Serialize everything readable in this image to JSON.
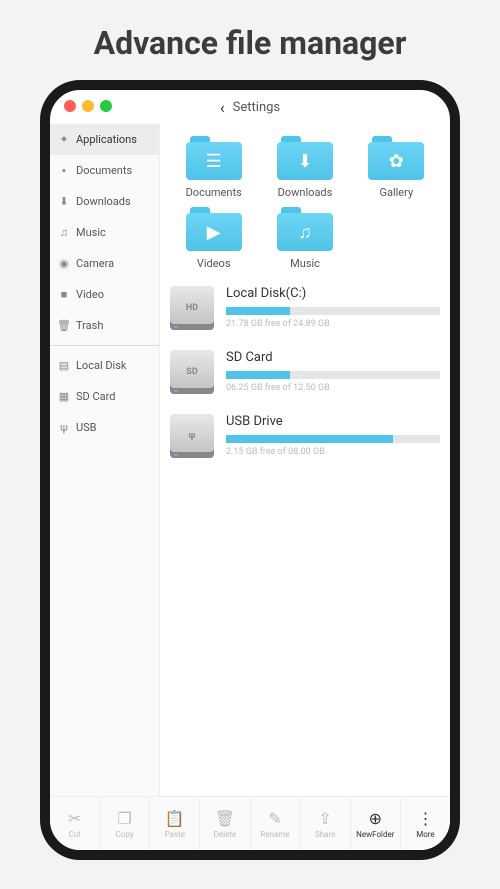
{
  "page_title": "Advance file manager",
  "titlebar": {
    "back": "‹",
    "title": "Settings"
  },
  "sidebar": {
    "items_top": [
      {
        "icon": "✦",
        "label": "Applications",
        "active": true
      },
      {
        "icon": "▪",
        "label": "Documents"
      },
      {
        "icon": "⬇",
        "label": "Downloads"
      },
      {
        "icon": "♫",
        "label": "Music"
      },
      {
        "icon": "◉",
        "label": "Camera"
      },
      {
        "icon": "■",
        "label": "Video"
      },
      {
        "icon": "🗑",
        "label": "Trash"
      }
    ],
    "items_bottom": [
      {
        "icon": "▤",
        "label": "Local Disk"
      },
      {
        "icon": "▦",
        "label": "SD Card"
      },
      {
        "icon": "ψ",
        "label": "USB"
      }
    ]
  },
  "folders": [
    {
      "glyph": "☰",
      "label": "Documents"
    },
    {
      "glyph": "⬇",
      "label": "Downloads"
    },
    {
      "glyph": "✿",
      "label": "Gallery"
    },
    {
      "glyph": "▶",
      "label": "Videos"
    },
    {
      "glyph": "♫",
      "label": "Music"
    }
  ],
  "drives": [
    {
      "badge": "HD",
      "name": "Local Disk(C:)",
      "percent": 30,
      "sub": "21.78 GB free of 24.89 GB"
    },
    {
      "badge": "SD",
      "name": "SD Card",
      "percent": 30,
      "sub": "06.25 GB free of 12.50 GB"
    },
    {
      "badge": "ψ",
      "name": "USB Drive",
      "percent": 78,
      "sub": "2.15 GB free of 08.00 GB"
    }
  ],
  "toolbar": [
    {
      "icon": "✂",
      "label": "Cut"
    },
    {
      "icon": "❐",
      "label": "Copy"
    },
    {
      "icon": "📋",
      "label": "Paste"
    },
    {
      "icon": "🗑",
      "label": "Delete"
    },
    {
      "icon": "✎",
      "label": "Rename"
    },
    {
      "icon": "⇪",
      "label": "Share"
    },
    {
      "icon": "⊕",
      "label": "NewFolder",
      "dark": true
    },
    {
      "icon": "⋮",
      "label": "More",
      "dark": true
    }
  ]
}
